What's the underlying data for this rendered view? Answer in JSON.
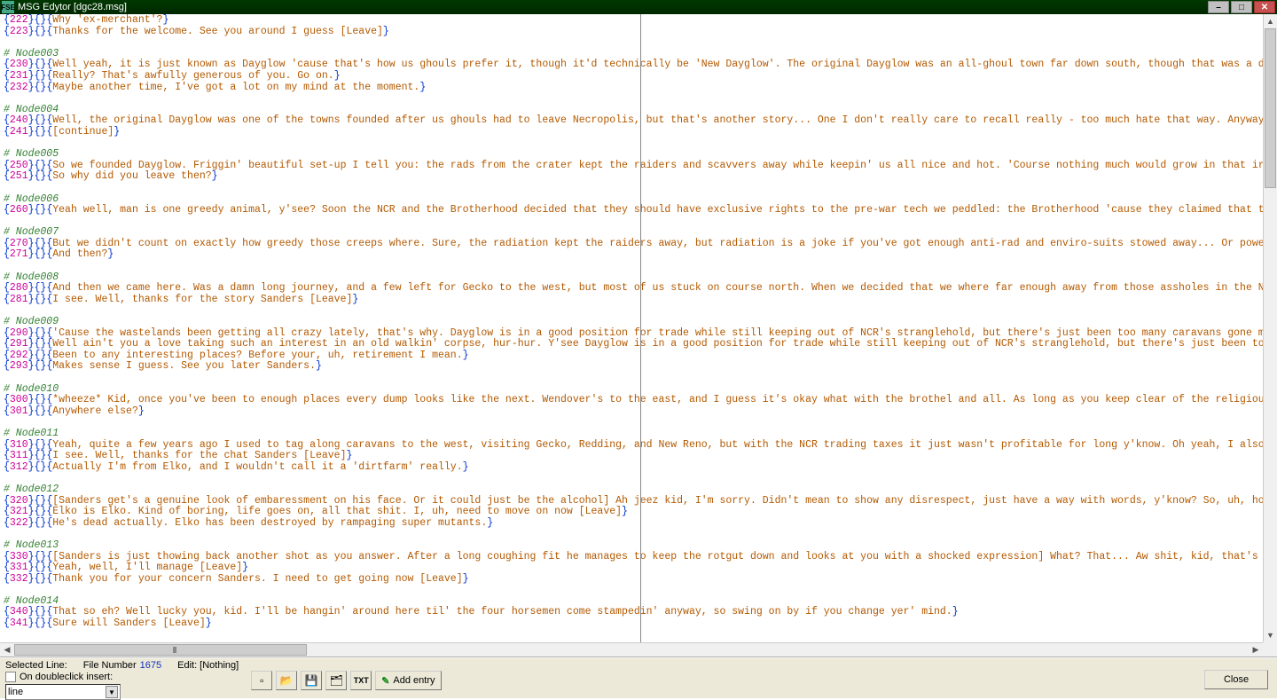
{
  "window": {
    "title": "MSG Edytor [dgc28.msg]",
    "icon_label": "FSE"
  },
  "win_buttons": {
    "min": "–",
    "max": "□",
    "close": "✕"
  },
  "status": {
    "selected_line_label": "Selected Line:",
    "file_number_label": "File Number",
    "file_number_value": "1675",
    "edit_label": "Edit: [Nothing]",
    "dblclick_label": "On doubleclick insert:",
    "combo_value": "line",
    "add_entry_label": "Add entry",
    "close_label": "Close",
    "txt_label": "TXT"
  },
  "lines": [
    {
      "type": "entry",
      "id": "222",
      "text": "Why 'ex-merchant'?"
    },
    {
      "type": "entry",
      "id": "223",
      "text": "Thanks for the welcome. See you around I guess [Leave]"
    },
    {
      "type": "blank"
    },
    {
      "type": "comment",
      "text": "# Node003"
    },
    {
      "type": "entry",
      "id": "230",
      "text": "Well yeah, it is just known as Dayglow 'cause that's how us ghouls prefer it, though it'd technically be 'New Dayglow'. The original Dayglow was an all-ghoul town far down south, though that was a damn long time ago. Care to hear"
    },
    {
      "type": "entry",
      "id": "231",
      "text": "Really? That's awfully generous of you. Go on."
    },
    {
      "type": "entry",
      "id": "232",
      "text": "Maybe another time, I've got a lot on my mind at the moment."
    },
    {
      "type": "blank"
    },
    {
      "type": "comment",
      "text": "# Node004"
    },
    {
      "type": "entry",
      "id": "240",
      "text": "Well, the original Dayglow was one of the towns founded after us ghouls had to leave Necropolis, but that's another story... One I don't really care to recall really - too much hate that way. Anyway, a lot of us ghouls knew about"
    },
    {
      "type": "entry",
      "id": "241",
      "text": "[continue]"
    },
    {
      "type": "blank"
    },
    {
      "type": "comment",
      "text": "# Node005"
    },
    {
      "type": "entry",
      "id": "250",
      "text": "So we founded Dayglow. Friggin' beautiful set-up I tell you: the rads from the crater kept the raiders and scavvers away while keepin' us all nice and hot. 'Course nothing much would grow in that irradiated soil, but we fixed tha"
    },
    {
      "type": "entry",
      "id": "251",
      "text": "So why did you leave then?"
    },
    {
      "type": "blank"
    },
    {
      "type": "comment",
      "text": "# Node006"
    },
    {
      "type": "entry",
      "id": "260",
      "text": "Yeah well, man is one greedy animal, y'see? Soon the NCR and the Brotherhood decided that they should have exclusive rights to the pre-war tech we peddled: the Brotherhood 'cause they claimed that the Glow was a 'sacred place' to"
    },
    {
      "type": "blank"
    },
    {
      "type": "comment",
      "text": "# Node007"
    },
    {
      "type": "entry",
      "id": "270",
      "text": "But we didn't count on exactly how greedy those creeps where. Sure, the radiation kept the raiders away, but radiation is a joke if you've got enough anti-rad and enviro-suits stowed away... Or power armor. Se we found us sandwic"
    },
    {
      "type": "entry",
      "id": "271",
      "text": "And then?"
    },
    {
      "type": "blank"
    },
    {
      "type": "comment",
      "text": "# Node008"
    },
    {
      "type": "entry",
      "id": "280",
      "text": "And then we came here. Was a damn long journey, and a few left for Gecko to the west, but most of us stuck on course north. When we decided that we where far enough away from those assholes in the NCR and the holier-than-thou Pal"
    },
    {
      "type": "entry",
      "id": "281",
      "text": "I see. Well, thanks for the story Sanders [Leave]"
    },
    {
      "type": "blank"
    },
    {
      "type": "comment",
      "text": "# Node009"
    },
    {
      "type": "entry",
      "id": "290",
      "text": "'Cause the wastelands been getting all crazy lately, that's why. Dayglow is in a good position for trade while still keeping out of NCR's stranglehold, but there's just been too many caravans gone missing lately. Unless you've go"
    },
    {
      "type": "entry",
      "id": "291",
      "text": "Well ain't you a love taking such an interest in an old walkin' corpse, hur-hur. Y'see Dayglow is in a good position for trade while still keeping out of NCR's stranglehold, but there's just been too many caravans gone missing la"
    },
    {
      "type": "entry",
      "id": "292",
      "text": "Been to any interesting places? Before your, uh, retirement I mean."
    },
    {
      "type": "entry",
      "id": "293",
      "text": "Makes sense I guess. See you later Sanders."
    },
    {
      "type": "blank"
    },
    {
      "type": "comment",
      "text": "# Node010"
    },
    {
      "type": "entry",
      "id": "300",
      "text": "*wheeze* Kid, once you've been to enough places every dump looks like the next. Wendover's to the east, and I guess it's okay what with the brothel and all. As long as you keep clear of the religious nuts and the slavers at least"
    },
    {
      "type": "entry",
      "id": "301",
      "text": "Anywhere else?"
    },
    {
      "type": "blank"
    },
    {
      "type": "comment",
      "text": "# Node011"
    },
    {
      "type": "entry",
      "id": "310",
      "text": "Yeah, quite a few years ago I used to tag along caravans to the west, visiting Gecko, Redding, and New Reno, but with the NCR trading taxes it just wasn't profitable for long y'know. Oh yeah, I also used to visit this little dirt"
    },
    {
      "type": "entry",
      "id": "311",
      "text": "I see. Well, thanks for the chat Sanders [Leave]"
    },
    {
      "type": "entry",
      "id": "312",
      "text": "Actually I'm from Elko, and I wouldn't call it a 'dirtfarm' really."
    },
    {
      "type": "blank"
    },
    {
      "type": "comment",
      "text": "# Node012"
    },
    {
      "type": "entry",
      "id": "320",
      "text": "[Sanders get's a genuine look of embaressment on his face. Or it could just be the alcohol] Ah jeez kid, I'm sorry. Didn't mean to show any disrespect, just have a way with words, y'know? So, uh, how's Elko holdin' up? That smoot"
    },
    {
      "type": "entry",
      "id": "321",
      "text": "Elko is Elko. Kind of boring, life goes on, all that shit. I, uh, need to move on now [Leave]"
    },
    {
      "type": "entry",
      "id": "322",
      "text": "He's dead actually. Elko has been destroyed by rampaging super mutants."
    },
    {
      "type": "blank"
    },
    {
      "type": "comment",
      "text": "# Node013"
    },
    {
      "type": "entry",
      "id": "330",
      "text": "[Sanders is just thowing back another shot as you answer. After a long coughing fit he manages to keep the rotgut down and looks at you with a shocked expression] What? That... Aw shit, kid, that's just sad. Sorry if I brought ba"
    },
    {
      "type": "entry",
      "id": "331",
      "text": "Yeah, well, I'll manage [Leave]"
    },
    {
      "type": "entry",
      "id": "332",
      "text": "Thank you for your concern Sanders. I need to get going now [Leave]"
    },
    {
      "type": "blank"
    },
    {
      "type": "comment",
      "text": "# Node014"
    },
    {
      "type": "entry",
      "id": "340",
      "text": "That so eh? Well lucky you, kid. I'll be hangin' around here til' the four horsemen come stampedin' anyway, so swing on by if you change yer' mind."
    },
    {
      "type": "entry",
      "id": "341",
      "text": "Sure will Sanders [Leave]"
    }
  ]
}
